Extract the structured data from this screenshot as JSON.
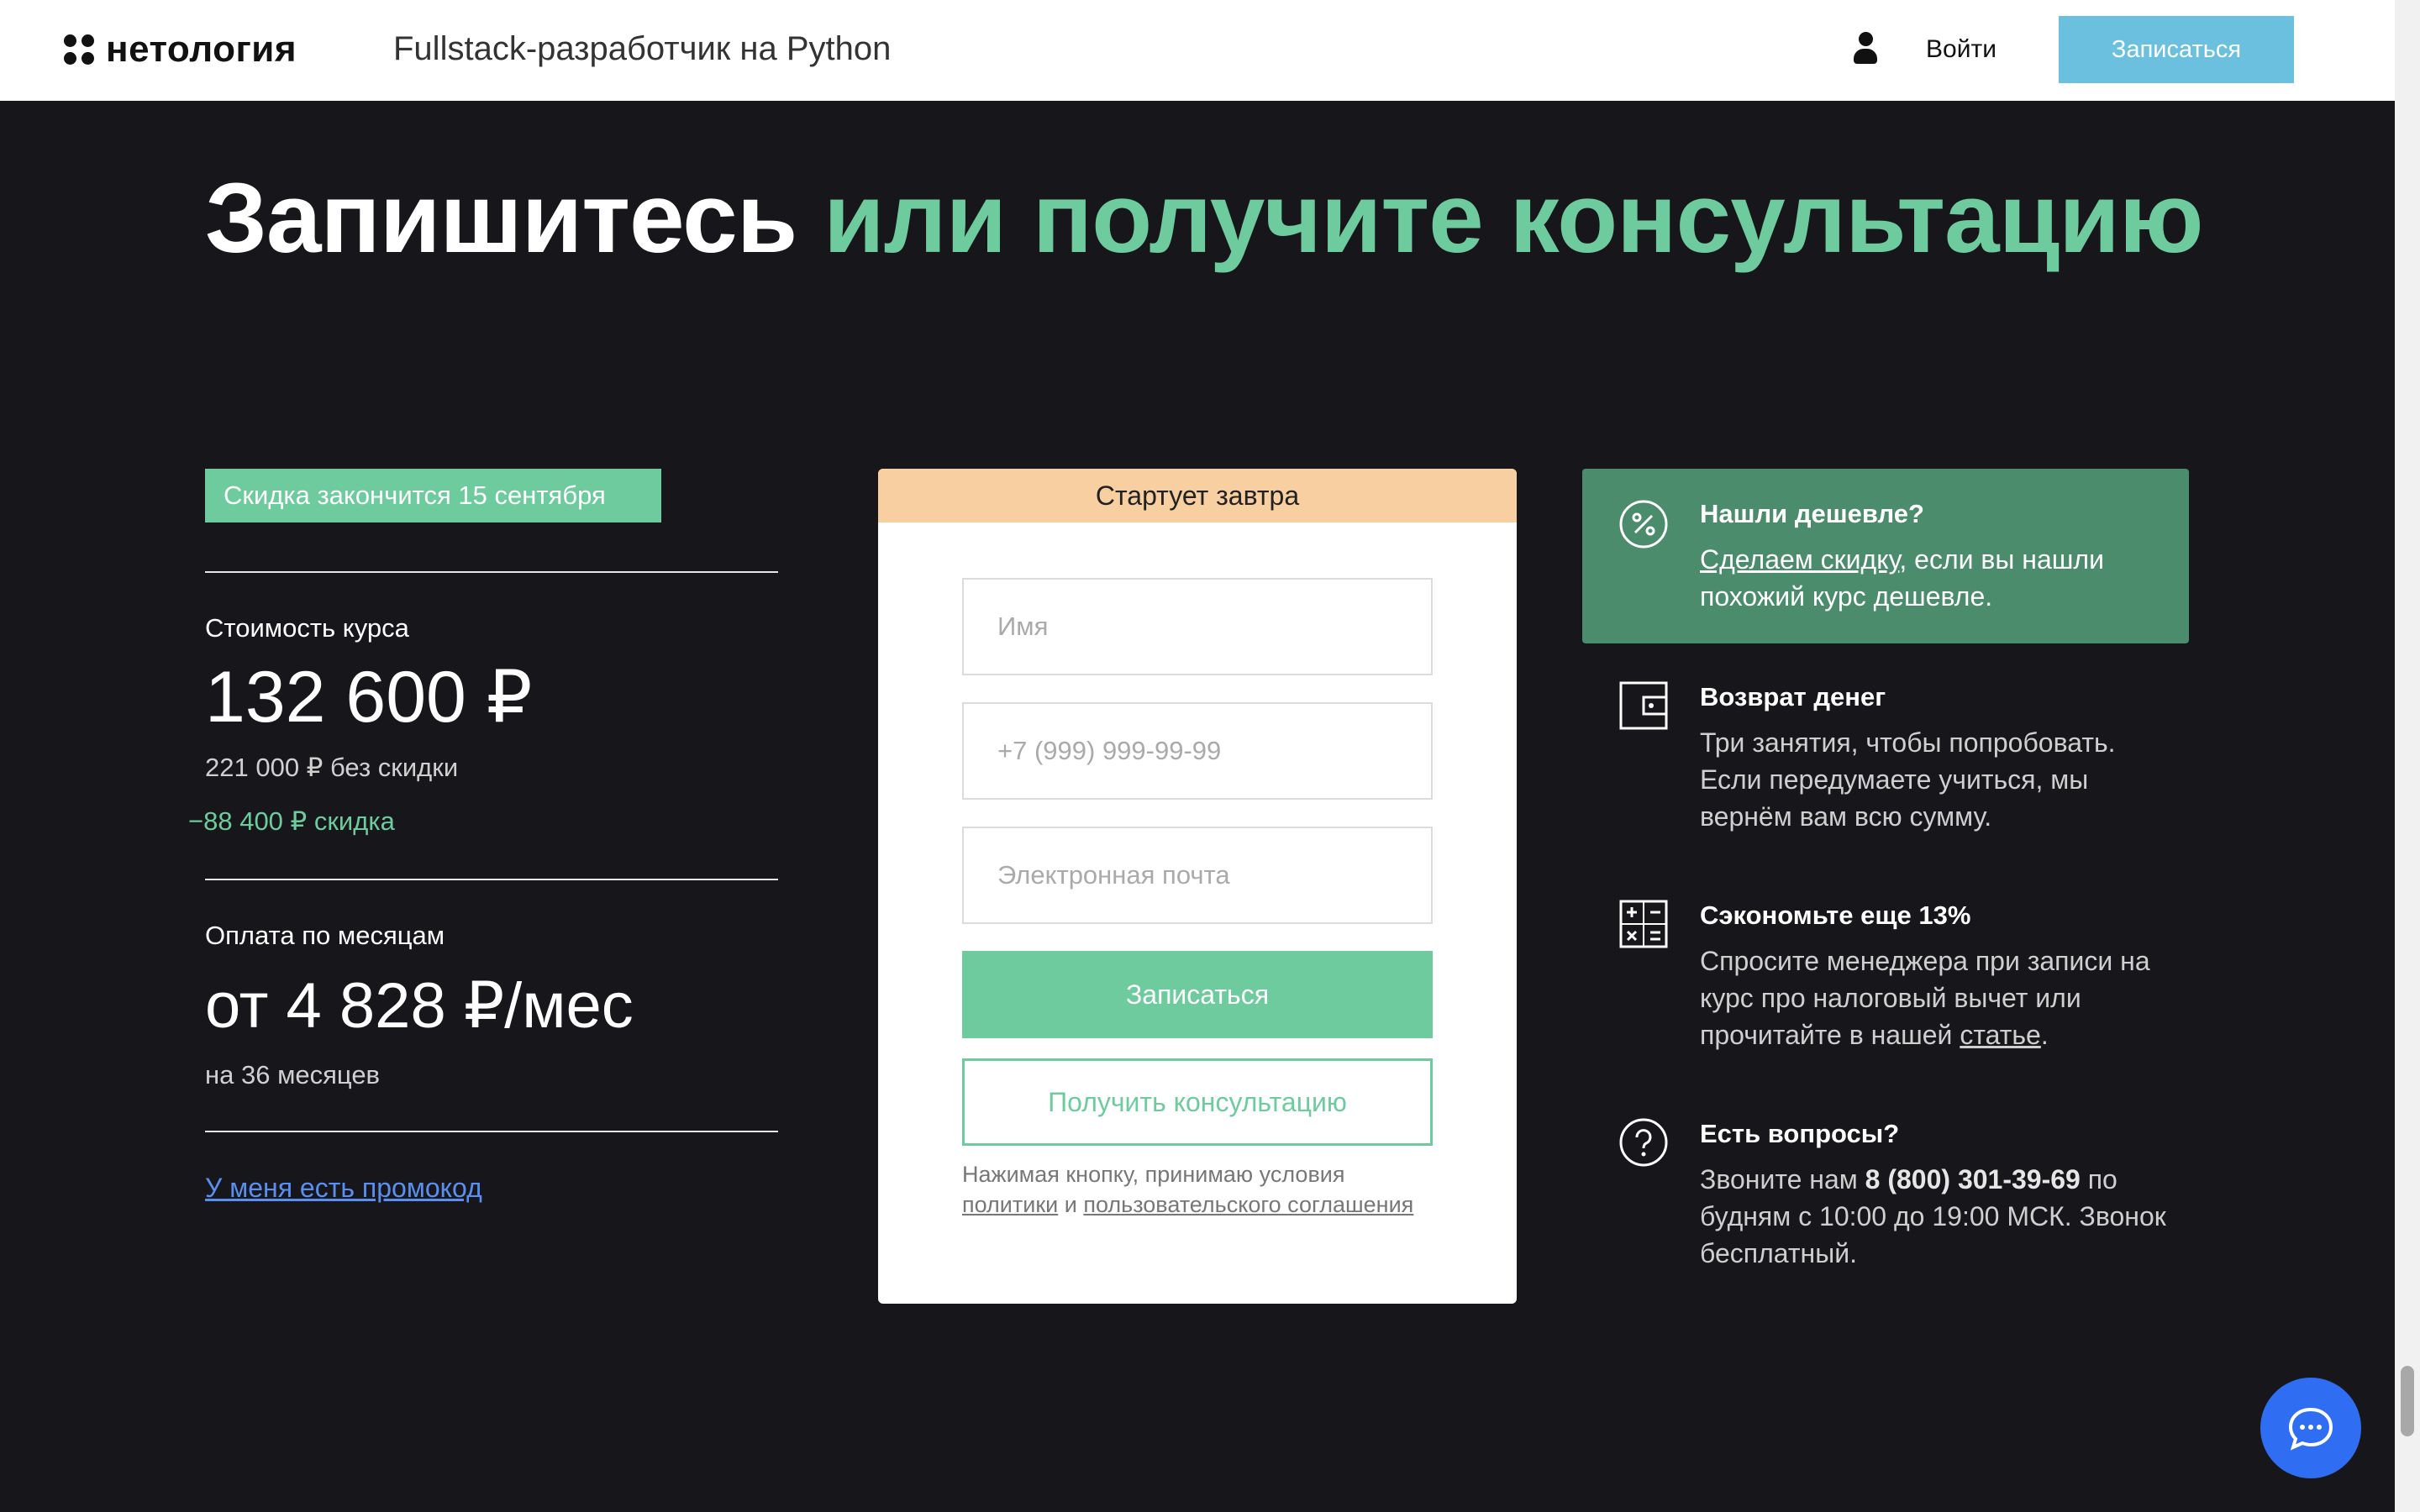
{
  "header": {
    "logo_text": "нетология",
    "course_title": "Fullstack-разработчик на Python",
    "login_label": "Войти",
    "cta_label": "Записаться"
  },
  "headline": {
    "part_white": "Запишитесь ",
    "part_green": "или получите консультацию"
  },
  "pricing": {
    "discount_badge": "Скидка закончится 15 сентября",
    "course_cost_label": "Стоимость курса",
    "price": "132 600 ₽",
    "price_old": "221 000 ₽ без скидки",
    "discount": "−88 400 ₽ скидка",
    "monthly_label": "Оплата по месяцам",
    "monthly_price": "от 4 828 ₽/мес",
    "monthly_term": "на 36 месяцев",
    "promo_link": "У меня есть промокод"
  },
  "form": {
    "top_label": "Стартует завтра",
    "name_placeholder": "Имя",
    "phone_placeholder": "+7 (999) 999-99-99",
    "email_placeholder": "Электронная почта",
    "submit_label": "Записаться",
    "consult_label": "Получить консультацию",
    "terms_prefix": "Нажимая кнопку, принимаю условия ",
    "terms_policy": "политики",
    "terms_and": " и ",
    "terms_agreement": "пользовательского соглашения"
  },
  "info": {
    "cheaper_title": "Нашли дешевле?",
    "cheaper_link": "Сделаем скидку",
    "cheaper_text": ", если вы нашли похожий курс дешевле.",
    "refund_title": "Возврат денег",
    "refund_text": "Три занятия, чтобы попробовать. Если передумаете учиться, мы вернём вам всю сумму.",
    "save_title": "Сэкономьте еще 13%",
    "save_text": "Спросите менеджера при записи на курс про налоговый вычет или прочитайте в нашей ",
    "save_link": "статье",
    "save_end": ".",
    "questions_title": "Есть вопросы?",
    "questions_prefix": "Звоните нам ",
    "questions_phone": "8 (800) 301-39-69",
    "questions_suffix": " по будням с 10:00 до 19:00 МСК. Звонок бесплатный."
  },
  "colors": {
    "background": "#17171b",
    "accent_green": "#6ecb9e",
    "header_cta": "#6cc0df",
    "badge_orange": "#f8cfa1",
    "promo_box": "#4a8c6b",
    "link_blue": "#5a8ff0",
    "chat_blue": "#2f6ef2"
  },
  "icons": {
    "user": "user-icon",
    "percent": "percent-icon",
    "wallet": "wallet-icon",
    "calculator": "calculator-icon",
    "question": "question-icon",
    "chat": "chat-icon"
  }
}
